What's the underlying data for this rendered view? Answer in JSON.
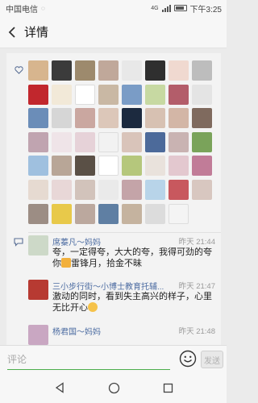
{
  "status_bar": {
    "carrier": "中国电信",
    "time": "下午3:25",
    "network": "4G"
  },
  "nav": {
    "title": "详情"
  },
  "likes": {
    "icon": "heart-icon",
    "avatars": [
      "#d7b58e",
      "#3b3b3b",
      "#9d8a6d",
      "#c0a89a",
      "#e8e8e8",
      "#2f2f2f",
      "#f0d9d0",
      "#bdbdbd",
      "#c1272d",
      "#f2e9d8",
      "#ffffff",
      "#c9b8a4",
      "#7a9cc6",
      "#c7d9a2",
      "#b35d6a",
      "#e4e4e4",
      "#6b8db8",
      "#d6d6d6",
      "#caa7a0",
      "#dcc7b9",
      "#1c2a3f",
      "#d7c1b2",
      "#d3b6a6",
      "#7f6a5e",
      "#c0a4b0",
      "#efe4e8",
      "#e6d2d8",
      "#f2f2f2",
      "#d9c4ba",
      "#4c6a9a",
      "#c9b3b2",
      "#7aa35a",
      "#9fc0df",
      "#b8a697",
      "#5a5046",
      "#ffffff",
      "#b5c77c",
      "#e9e2dc",
      "#e3c8cf",
      "#c17c98",
      "#e6dad1",
      "#e8d7d7",
      "#d2c3bb",
      "#eaeaea",
      "#c4a4a8",
      "#b8d4e9",
      "#c8585e",
      "#d8c7c0",
      "#9c8d84",
      "#e8c94a",
      "#bba89e",
      "#5f7fa3",
      "#c5b39f",
      "#dcdcdc",
      "#f4f4f4"
    ]
  },
  "comments": [
    {
      "name": "席蓁凡～妈妈",
      "time": "昨天 21:44",
      "avatar": "#cdd9c8",
      "text_main": "夸，一定得夸，大大的夸，我得可劲的夸你",
      "text_tail": "雷锋月，拾金不昧"
    },
    {
      "name": "三小步行街～小博士教育托辅...",
      "time": "昨天 21:47",
      "avatar": "#b73a32",
      "text_main": "激动的同时，看到失主高兴的样子，心里无比开心"
    },
    {
      "name": "杨君国～妈妈",
      "time": "昨天 21:48",
      "avatar": "#c9a7c2"
    }
  ],
  "input_bar": {
    "placeholder": "评论",
    "emoji": "smiley-icon",
    "send_label": "发送"
  },
  "system_nav": {
    "back": "triangle-back-icon",
    "home": "circle-home-icon",
    "recents": "square-recents-icon"
  }
}
